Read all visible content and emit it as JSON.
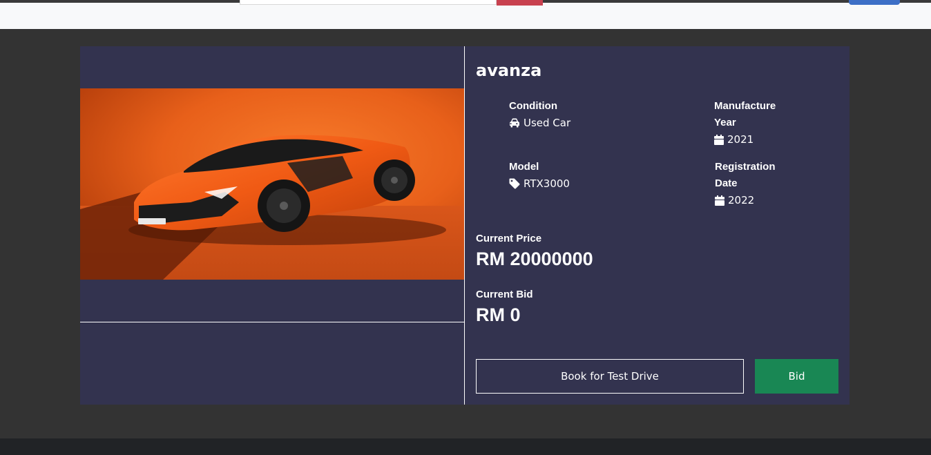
{
  "car": {
    "name": "avanza",
    "image_alt": "Orange sports car"
  },
  "specs": {
    "condition": {
      "label": "Condition",
      "value": "Used Car",
      "icon": "car-icon"
    },
    "manufacture_year": {
      "label": "Manufacture Year",
      "value": "2021",
      "icon": "calendar-icon"
    },
    "model": {
      "label": "Model",
      "value": "RTX3000",
      "icon": "tag-icon"
    },
    "registration_date": {
      "label": "Registration Date",
      "value": "2022",
      "icon": "calendar-icon"
    }
  },
  "pricing": {
    "current_price_label": "Current Price",
    "current_price": "RM 20000000",
    "current_bid_label": "Current Bid",
    "current_bid": "RM 0"
  },
  "actions": {
    "test_drive_label": "Book for Test Drive",
    "bid_label": "Bid"
  },
  "colors": {
    "card_bg": "#33334f",
    "page_bg": "#333333",
    "bid_button": "#198754"
  }
}
